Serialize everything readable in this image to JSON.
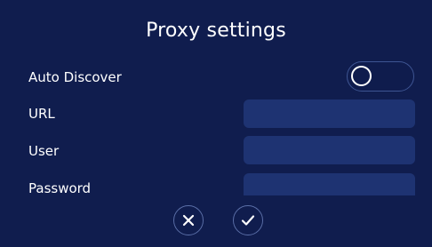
{
  "dialog": {
    "title": "Proxy settings"
  },
  "fields": {
    "auto_discover_label": "Auto Discover",
    "auto_discover_enabled": false,
    "url_label": "URL",
    "url_value": "",
    "user_label": "User",
    "user_value": "",
    "password_label": "Password",
    "password_value": ""
  },
  "buttons": {
    "cancel_icon": "close-icon",
    "confirm_icon": "checkmark-icon"
  },
  "colors": {
    "background": "#101d4e",
    "field": "#1e3372",
    "border": "#3e5593"
  }
}
